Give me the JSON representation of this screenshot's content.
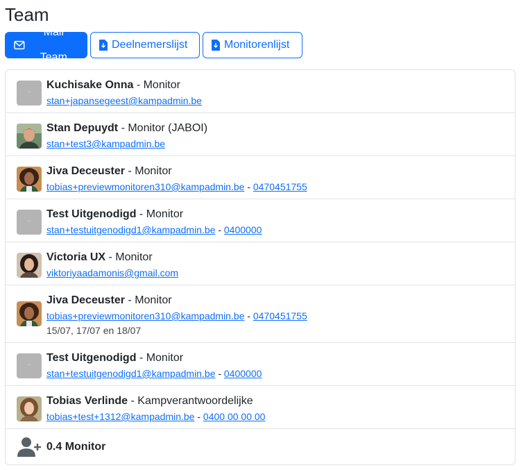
{
  "page": {
    "title": "Team"
  },
  "toolbar": {
    "mail_label": "Mail Team",
    "participants_label": "Deelnemerslijst",
    "monitors_label": "Monitorenlijst"
  },
  "colors": {
    "primary": "#0d6efd",
    "border": "#dee2e6",
    "placeholder": "#b4b4b4"
  },
  "members": [
    {
      "name": "Kuchisake Onna",
      "role": " - Monitor",
      "email": "stan+japansegeest@kampadmin.be",
      "phone": "",
      "dates": "",
      "avatar": "placeholder"
    },
    {
      "name": "Stan Depuydt",
      "role": " - Monitor (JABOI)",
      "email": "stan+test3@kampadmin.be",
      "phone": "",
      "dates": "",
      "avatar": "man"
    },
    {
      "name": "Jiva Deceuster",
      "role": " - Monitor",
      "email": "tobias+previewmonitoren310@kampadmin.be",
      "phone": "0470451755",
      "dates": "",
      "avatar": "woman-curly"
    },
    {
      "name": "Test Uitgenodigd",
      "role": " - Monitor",
      "email": "stan+testuitgenodigd1@kampadmin.be",
      "phone": "0400000",
      "dates": "",
      "avatar": "placeholder"
    },
    {
      "name": "Victoria UX",
      "role": " - Monitor",
      "email": "viktoriyaadamonis@gmail.com",
      "phone": "",
      "dates": "",
      "avatar": "woman-dark"
    },
    {
      "name": "Jiva Deceuster",
      "role": " - Monitor",
      "email": "tobias+previewmonitoren310@kampadmin.be",
      "phone": "0470451755",
      "dates": "15/07, 17/07 en 18/07",
      "avatar": "woman-curly"
    },
    {
      "name": "Test Uitgenodigd",
      "role": " - Monitor",
      "email": "stan+testuitgenodigd1@kampadmin.be",
      "phone": "0400000",
      "dates": "",
      "avatar": "placeholder"
    },
    {
      "name": "Tobias Verlinde",
      "role": " - Kampverantwoordelijke",
      "email": "tobias+test+1312@kampadmin.be",
      "phone": "0400 00 00 00",
      "dates": "",
      "avatar": "woman-light"
    }
  ],
  "add_slot": {
    "label": "0.4 Monitor",
    "icon": "user-plus-icon"
  },
  "phone_separator": " - "
}
